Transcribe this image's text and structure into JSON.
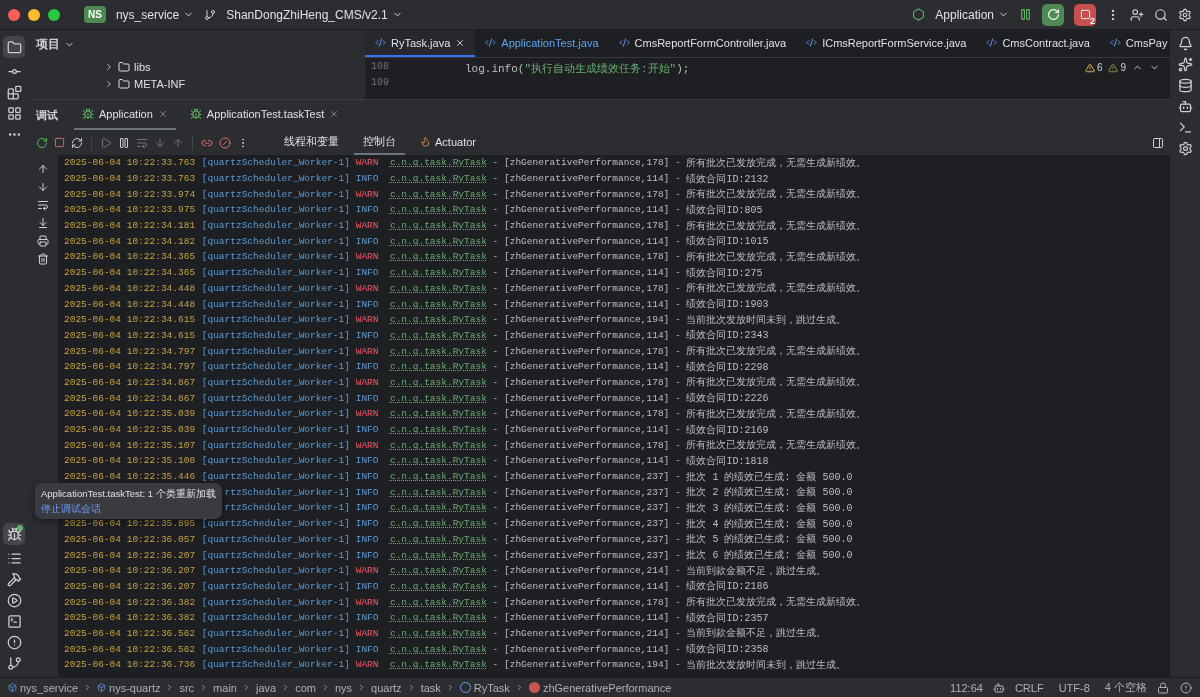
{
  "title_bar": {
    "project_badge": "NS",
    "project": "nys_service",
    "branch": "ShanDongZhiHeng_CMS/v2.1",
    "run_config": "Application",
    "debug_count": "2"
  },
  "project_panel": {
    "title": "项目",
    "items": [
      {
        "label": "libs"
      },
      {
        "label": "META-INF"
      }
    ]
  },
  "editor": {
    "tabs": [
      {
        "label": "RyTask.java",
        "selected": true,
        "modified": false
      },
      {
        "label": "ApplicationTest.java",
        "selected": false,
        "modified": true
      },
      {
        "label": "CmsReportFormController.java",
        "selected": false,
        "modified": false
      },
      {
        "label": "ICmsReportFormService.java",
        "selected": false,
        "modified": false
      },
      {
        "label": "CmsContract.java",
        "selected": false,
        "modified": false
      },
      {
        "label": "CmsPay",
        "selected": false,
        "modified": false
      }
    ],
    "lines": [
      {
        "number": "108",
        "parts": [
          {
            "text": "log.info(",
            "kind": "plain"
          },
          {
            "text": "\"执行自动生成绩效任务:开始\"",
            "kind": "string"
          },
          {
            "text": ");",
            "kind": "plain"
          }
        ]
      },
      {
        "number": "109"
      }
    ],
    "warnings": "6",
    "weak_warnings": "9"
  },
  "debug": {
    "title": "调试",
    "sessions": [
      {
        "label": "Application",
        "selected": true
      },
      {
        "label": "ApplicationTest.taskTest",
        "selected": false
      }
    ],
    "views": [
      {
        "label": "线程和变量",
        "selected": false
      },
      {
        "label": "控制台",
        "selected": true
      },
      {
        "label": "Actuator",
        "selected": false
      }
    ],
    "log": [
      {
        "time": "2025-06-04 10:22:33.763",
        "thread": "[quartzScheduler_Worker-1]",
        "level": "WARN",
        "kind": "warn",
        "logger": "c.n.q.task.RyTask",
        "source": "- [zhGenerativePerformance,178] -",
        "message": "所有批次已发放完成，无需生成新绩效。"
      },
      {
        "time": "2025-06-04 10:22:33.763",
        "thread": "[quartzScheduler_Worker-1]",
        "level": "INFO",
        "kind": "info",
        "logger": "c.n.q.task.RyTask",
        "source": "- [zhGenerativePerformance,114] -",
        "message": "绩效合同ID:2132"
      },
      {
        "time": "2025-06-04 10:22:33.974",
        "thread": "[quartzScheduler_Worker-1]",
        "level": "WARN",
        "kind": "warn",
        "logger": "c.n.q.task.RyTask",
        "source": "- [zhGenerativePerformance,178] -",
        "message": "所有批次已发放完成，无需生成新绩效。"
      },
      {
        "time": "2025-06-04 10:22:33.975",
        "thread": "[quartzScheduler_Worker-1]",
        "level": "INFO",
        "kind": "info",
        "logger": "c.n.q.task.RyTask",
        "source": "- [zhGenerativePerformance,114] -",
        "message": "绩效合同ID:805"
      },
      {
        "time": "2025-06-04 10:22:34.181",
        "thread": "[quartzScheduler_Worker-1]",
        "level": "WARN",
        "kind": "warn",
        "logger": "c.n.q.task.RyTask",
        "source": "- [zhGenerativePerformance,178] -",
        "message": "所有批次已发放完成，无需生成新绩效。"
      },
      {
        "time": "2025-06-04 10:22:34.182",
        "thread": "[quartzScheduler_Worker-1]",
        "level": "INFO",
        "kind": "info",
        "logger": "c.n.q.task.RyTask",
        "source": "- [zhGenerativePerformance,114] -",
        "message": "绩效合同ID:1015"
      },
      {
        "time": "2025-06-04 10:22:34.365",
        "thread": "[quartzScheduler_Worker-1]",
        "level": "WARN",
        "kind": "warn",
        "logger": "c.n.q.task.RyTask",
        "source": "- [zhGenerativePerformance,178] -",
        "message": "所有批次已发放完成，无需生成新绩效。"
      },
      {
        "time": "2025-06-04 10:22:34.365",
        "thread": "[quartzScheduler_Worker-1]",
        "level": "INFO",
        "kind": "info",
        "logger": "c.n.q.task.RyTask",
        "source": "- [zhGenerativePerformance,114] -",
        "message": "绩效合同ID:275"
      },
      {
        "time": "2025-06-04 10:22:34.448",
        "thread": "[quartzScheduler_Worker-1]",
        "level": "WARN",
        "kind": "warn",
        "logger": "c.n.q.task.RyTask",
        "source": "- [zhGenerativePerformance,178] -",
        "message": "所有批次已发放完成，无需生成新绩效。"
      },
      {
        "time": "2025-06-04 10:22:34.448",
        "thread": "[quartzScheduler_Worker-1]",
        "level": "INFO",
        "kind": "info",
        "logger": "c.n.q.task.RyTask",
        "source": "- [zhGenerativePerformance,114] -",
        "message": "绩效合同ID:1903"
      },
      {
        "time": "2025-06-04 10:22:34.615",
        "thread": "[quartzScheduler_Worker-1]",
        "level": "WARN",
        "kind": "warn",
        "logger": "c.n.q.task.RyTask",
        "source": "- [zhGenerativePerformance,194] -",
        "message": "当前批次发放时间未到，跳过生成。"
      },
      {
        "time": "2025-06-04 10:22:34.615",
        "thread": "[quartzScheduler_Worker-1]",
        "level": "INFO",
        "kind": "info",
        "logger": "c.n.q.task.RyTask",
        "source": "- [zhGenerativePerformance,114] -",
        "message": "绩效合同ID:2343"
      },
      {
        "time": "2025-06-04 10:22:34.797",
        "thread": "[quartzScheduler_Worker-1]",
        "level": "WARN",
        "kind": "warn",
        "logger": "c.n.q.task.RyTask",
        "source": "- [zhGenerativePerformance,178] -",
        "message": "所有批次已发放完成，无需生成新绩效。"
      },
      {
        "time": "2025-06-04 10:22:34.797",
        "thread": "[quartzScheduler_Worker-1]",
        "level": "INFO",
        "kind": "info",
        "logger": "c.n.q.task.RyTask",
        "source": "- [zhGenerativePerformance,114] -",
        "message": "绩效合同ID:2298"
      },
      {
        "time": "2025-06-04 10:22:34.867",
        "thread": "[quartzScheduler_Worker-1]",
        "level": "WARN",
        "kind": "warn",
        "logger": "c.n.q.task.RyTask",
        "source": "- [zhGenerativePerformance,178] -",
        "message": "所有批次已发放完成，无需生成新绩效。"
      },
      {
        "time": "2025-06-04 10:22:34.867",
        "thread": "[quartzScheduler_Worker-1]",
        "level": "INFO",
        "kind": "info",
        "logger": "c.n.q.task.RyTask",
        "source": "- [zhGenerativePerformance,114] -",
        "message": "绩效合同ID:2226"
      },
      {
        "time": "2025-06-04 10:22:35.039",
        "thread": "[quartzScheduler_Worker-1]",
        "level": "WARN",
        "kind": "warn",
        "logger": "c.n.q.task.RyTask",
        "source": "- [zhGenerativePerformance,178] -",
        "message": "所有批次已发放完成，无需生成新绩效。"
      },
      {
        "time": "2025-06-04 10:22:35.039",
        "thread": "[quartzScheduler_Worker-1]",
        "level": "INFO",
        "kind": "info",
        "logger": "c.n.q.task.RyTask",
        "source": "- [zhGenerativePerformance,114] -",
        "message": "绩效合同ID:2169"
      },
      {
        "time": "2025-06-04 10:22:35.107",
        "thread": "[quartzScheduler_Worker-1]",
        "level": "WARN",
        "kind": "warn",
        "logger": "c.n.q.task.RyTask",
        "source": "- [zhGenerativePerformance,178] -",
        "message": "所有批次已发放完成，无需生成新绩效。"
      },
      {
        "time": "2025-06-04 10:22:35.108",
        "thread": "[quartzScheduler_Worker-1]",
        "level": "INFO",
        "kind": "info",
        "logger": "c.n.q.task.RyTask",
        "source": "- [zhGenerativePerformance,114] -",
        "message": "绩效合同ID:1818"
      },
      {
        "time": "2025-06-04 10:22:35.446",
        "thread": "[quartzScheduler_Worker-1]",
        "level": "INFO",
        "kind": "info",
        "logger": "c.n.q.task.RyTask",
        "source": "- [zhGenerativePerformance,237] -",
        "message": "批次 1 的绩效已生成: 金额 500.0"
      },
      {
        "thread": "rtzScheduler_Worker-1]",
        "level": "INFO",
        "kind": "info",
        "logger": "c.n.q.task.RyTask",
        "source": "- [zhGenerativePerformance,237] -",
        "message": "批次 2 的绩效已生成: 金额 500.0"
      },
      {
        "thread": "rtzScheduler_Worker-1]",
        "level": "INFO",
        "kind": "info",
        "logger": "c.n.q.task.RyTask",
        "source": "- [zhGenerativePerformance,237] -",
        "message": "批次 3 的绩效已生成: 金额 500.0"
      },
      {
        "time": "2025-06-04 10:22:35.895",
        "thread": "[quartzScheduler_Worker-1]",
        "level": "INFO",
        "kind": "info",
        "logger": "c.n.q.task.RyTask",
        "source": "- [zhGenerativePerformance,237] -",
        "message": "批次 4 的绩效已生成: 金额 500.0"
      },
      {
        "time": "2025-06-04 10:22:36.057",
        "thread": "[quartzScheduler_Worker-1]",
        "level": "INFO",
        "kind": "info",
        "logger": "c.n.q.task.RyTask",
        "source": "- [zhGenerativePerformance,237] -",
        "message": "批次 5 的绩效已生成: 金额 500.0"
      },
      {
        "time": "2025-06-04 10:22:36.207",
        "thread": "[quartzScheduler_Worker-1]",
        "level": "INFO",
        "kind": "info",
        "logger": "c.n.q.task.RyTask",
        "source": "- [zhGenerativePerformance,237] -",
        "message": "批次 6 的绩效已生成: 金额 500.0"
      },
      {
        "time": "2025-06-04 10:22:36.207",
        "thread": "[quartzScheduler_Worker-1]",
        "level": "WARN",
        "kind": "warn",
        "logger": "c.n.q.task.RyTask",
        "source": "- [zhGenerativePerformance,214] -",
        "message": "当前到款金额不足，跳过生成。"
      },
      {
        "time": "2025-06-04 10:22:36.207",
        "thread": "[quartzScheduler_Worker-1]",
        "level": "INFO",
        "kind": "info",
        "logger": "c.n.q.task.RyTask",
        "source": "- [zhGenerativePerformance,114] -",
        "message": "绩效合同ID:2186"
      },
      {
        "time": "2025-06-04 10:22:36.382",
        "thread": "[quartzScheduler_Worker-1]",
        "level": "WARN",
        "kind": "warn",
        "logger": "c.n.q.task.RyTask",
        "source": "- [zhGenerativePerformance,178] -",
        "message": "所有批次已发放完成，无需生成新绩效。"
      },
      {
        "time": "2025-06-04 10:22:36.382",
        "thread": "[quartzScheduler_Worker-1]",
        "level": "INFO",
        "kind": "info",
        "logger": "c.n.q.task.RyTask",
        "source": "- [zhGenerativePerformance,114] -",
        "message": "绩效合同ID:2357"
      },
      {
        "time": "2025-06-04 10:22:36.562",
        "thread": "[quartzScheduler_Worker-1]",
        "level": "WARN",
        "kind": "warn",
        "logger": "c.n.q.task.RyTask",
        "source": "- [zhGenerativePerformance,214] -",
        "message": "当前到款金额不足，跳过生成。"
      },
      {
        "time": "2025-06-04 10:22:36.562",
        "thread": "[quartzScheduler_Worker-1]",
        "level": "INFO",
        "kind": "info",
        "logger": "c.n.q.task.RyTask",
        "source": "- [zhGenerativePerformance,114] -",
        "message": "绩效合同ID:2358"
      },
      {
        "time": "2025-06-04 10:22:36.736",
        "thread": "[quartzScheduler_Worker-1]",
        "level": "WARN",
        "kind": "warn",
        "logger": "c.n.q.task.RyTask",
        "source": "- [zhGenerativePerformance,194] -",
        "message": "当前批次发放时间未到，跳过生成。"
      }
    ]
  },
  "tooltip": {
    "text": "ApplicationTest.taskTest: 1 个类重新加载",
    "link": "停止调试会话"
  },
  "status_bar": {
    "breadcrumbs": [
      {
        "label": "nys_service",
        "kind": "module"
      },
      {
        "label": "nys-quartz",
        "kind": "module"
      },
      {
        "label": "src",
        "kind": "folder"
      },
      {
        "label": "main",
        "kind": "folder"
      },
      {
        "label": "java",
        "kind": "folder"
      },
      {
        "label": "com",
        "kind": "folder"
      },
      {
        "label": "nys",
        "kind": "folder"
      },
      {
        "label": "quartz",
        "kind": "folder"
      },
      {
        "label": "task",
        "kind": "folder"
      },
      {
        "label": "RyTask",
        "kind": "class"
      },
      {
        "label": "zhGenerativePerformance",
        "kind": "method"
      }
    ],
    "position": "112:64",
    "line_ending": "CRLF",
    "encoding": "UTF-8",
    "indent": "4 个空格"
  }
}
